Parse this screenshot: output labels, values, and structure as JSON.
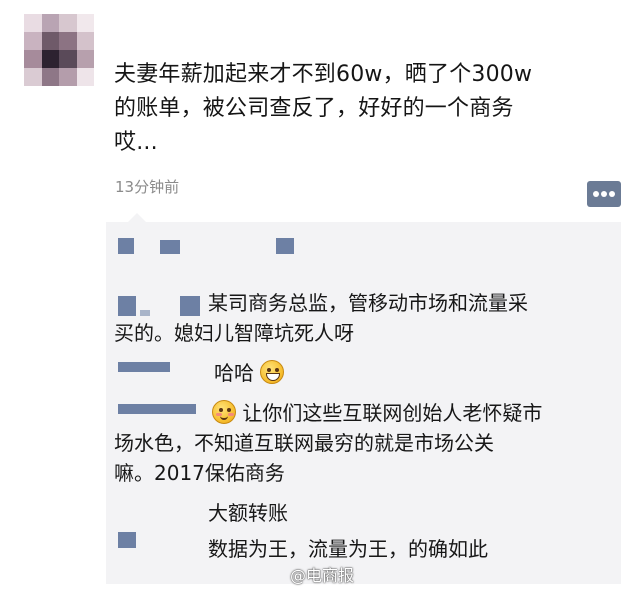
{
  "post": {
    "text_line1": "夫妻年薪加起来才不到60w，晒了个300w",
    "text_line2": "的账单，被公司查反了，好好的一个商务",
    "text_line3": "哎...",
    "timestamp": "13分钟前"
  },
  "comments": {
    "c1_line1": "某司商务总监，管移动市场和流量采",
    "c1_line2": "买的。媳妇儿智障坑死人呀",
    "c2": "哈哈",
    "c3_line1": "让你们这些互联网创始人老怀疑市",
    "c3_line2": "场水色，不知道互联网最穷的就是市场公关",
    "c3_line3": "嘛。2017保佑商务",
    "c4": "大额转账",
    "c5": "数据为王，流量为王，的确如此"
  },
  "watermark": "@电商报",
  "icons": {
    "more": "more-icon",
    "laugh": "laughing-emoji-icon",
    "shy": "blushing-emoji-icon"
  },
  "colors": {
    "comment_bg": "#f3f3f5",
    "action_button": "#6b7b95",
    "name_blue": "#4f6792"
  }
}
